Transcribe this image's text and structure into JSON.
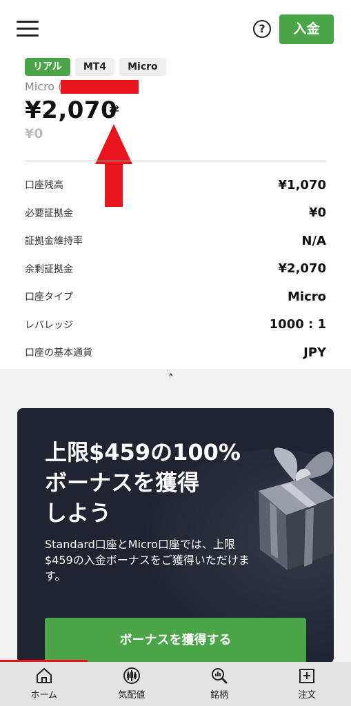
{
  "header": {
    "deposit_label": "入金",
    "help_symbol": "?"
  },
  "account": {
    "tags": [
      "リアル",
      "MT4",
      "Micro"
    ],
    "name": "Micro (",
    "equity": "¥2,070",
    "swap_symbol": "⇄",
    "profit": "¥0"
  },
  "details": [
    {
      "label": "口座残高",
      "value": "¥1,070"
    },
    {
      "label": "必要証拠金",
      "value": "¥0"
    },
    {
      "label": "証拠金維持率",
      "value": "N/A"
    },
    {
      "label": "余剰証拠金",
      "value": "¥2,070"
    },
    {
      "label": "口座タイプ",
      "value": "Micro"
    },
    {
      "label": "レバレッジ",
      "value": "1000 : 1"
    },
    {
      "label": "口座の基本通貨",
      "value": "JPY"
    }
  ],
  "collapse_symbol": "˄",
  "banner": {
    "title_line1": "上限$459の100%",
    "title_line2": "ボーナスを獲得",
    "title_line3": "しよう",
    "text": "Standard口座とMicro口座では、上限$459の入金ボーナスをご獲得いただけます。",
    "button_label": "ボーナスを獲得する"
  },
  "tabs": [
    {
      "label": "ホーム",
      "icon": "home-icon"
    },
    {
      "label": "気配値",
      "icon": "quotes-icon"
    },
    {
      "label": "銘柄",
      "icon": "symbol-search-icon"
    },
    {
      "label": "注文",
      "icon": "order-icon"
    }
  ],
  "colors": {
    "accent_green": "#4ba548",
    "annotation_red": "#e8141b",
    "banner_bg": "#1f2430"
  }
}
